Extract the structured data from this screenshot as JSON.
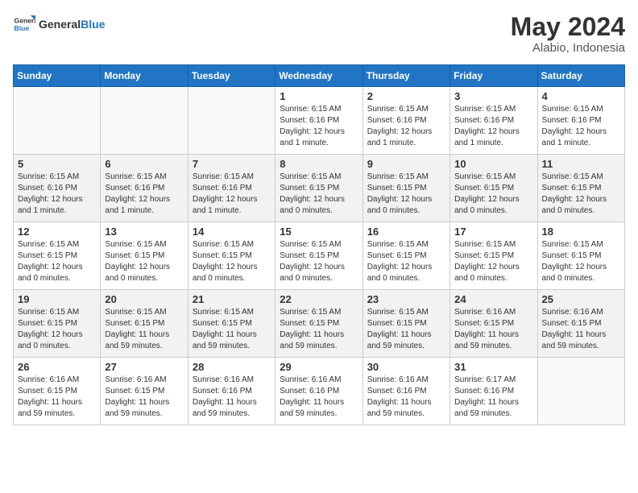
{
  "logo": {
    "general": "General",
    "blue": "Blue"
  },
  "title": "May 2024",
  "subtitle": "Alabio, Indonesia",
  "weekdays": [
    "Sunday",
    "Monday",
    "Tuesday",
    "Wednesday",
    "Thursday",
    "Friday",
    "Saturday"
  ],
  "weeks": [
    [
      {
        "day": "",
        "info": ""
      },
      {
        "day": "",
        "info": ""
      },
      {
        "day": "",
        "info": ""
      },
      {
        "day": "1",
        "info": "Sunrise: 6:15 AM\nSunset: 6:16 PM\nDaylight: 12 hours\nand 1 minute."
      },
      {
        "day": "2",
        "info": "Sunrise: 6:15 AM\nSunset: 6:16 PM\nDaylight: 12 hours\nand 1 minute."
      },
      {
        "day": "3",
        "info": "Sunrise: 6:15 AM\nSunset: 6:16 PM\nDaylight: 12 hours\nand 1 minute."
      },
      {
        "day": "4",
        "info": "Sunrise: 6:15 AM\nSunset: 6:16 PM\nDaylight: 12 hours\nand 1 minute."
      }
    ],
    [
      {
        "day": "5",
        "info": "Sunrise: 6:15 AM\nSunset: 6:16 PM\nDaylight: 12 hours\nand 1 minute."
      },
      {
        "day": "6",
        "info": "Sunrise: 6:15 AM\nSunset: 6:16 PM\nDaylight: 12 hours\nand 1 minute."
      },
      {
        "day": "7",
        "info": "Sunrise: 6:15 AM\nSunset: 6:16 PM\nDaylight: 12 hours\nand 1 minute."
      },
      {
        "day": "8",
        "info": "Sunrise: 6:15 AM\nSunset: 6:15 PM\nDaylight: 12 hours\nand 0 minutes."
      },
      {
        "day": "9",
        "info": "Sunrise: 6:15 AM\nSunset: 6:15 PM\nDaylight: 12 hours\nand 0 minutes."
      },
      {
        "day": "10",
        "info": "Sunrise: 6:15 AM\nSunset: 6:15 PM\nDaylight: 12 hours\nand 0 minutes."
      },
      {
        "day": "11",
        "info": "Sunrise: 6:15 AM\nSunset: 6:15 PM\nDaylight: 12 hours\nand 0 minutes."
      }
    ],
    [
      {
        "day": "12",
        "info": "Sunrise: 6:15 AM\nSunset: 6:15 PM\nDaylight: 12 hours\nand 0 minutes."
      },
      {
        "day": "13",
        "info": "Sunrise: 6:15 AM\nSunset: 6:15 PM\nDaylight: 12 hours\nand 0 minutes."
      },
      {
        "day": "14",
        "info": "Sunrise: 6:15 AM\nSunset: 6:15 PM\nDaylight: 12 hours\nand 0 minutes."
      },
      {
        "day": "15",
        "info": "Sunrise: 6:15 AM\nSunset: 6:15 PM\nDaylight: 12 hours\nand 0 minutes."
      },
      {
        "day": "16",
        "info": "Sunrise: 6:15 AM\nSunset: 6:15 PM\nDaylight: 12 hours\nand 0 minutes."
      },
      {
        "day": "17",
        "info": "Sunrise: 6:15 AM\nSunset: 6:15 PM\nDaylight: 12 hours\nand 0 minutes."
      },
      {
        "day": "18",
        "info": "Sunrise: 6:15 AM\nSunset: 6:15 PM\nDaylight: 12 hours\nand 0 minutes."
      }
    ],
    [
      {
        "day": "19",
        "info": "Sunrise: 6:15 AM\nSunset: 6:15 PM\nDaylight: 12 hours\nand 0 minutes."
      },
      {
        "day": "20",
        "info": "Sunrise: 6:15 AM\nSunset: 6:15 PM\nDaylight: 11 hours\nand 59 minutes."
      },
      {
        "day": "21",
        "info": "Sunrise: 6:15 AM\nSunset: 6:15 PM\nDaylight: 11 hours\nand 59 minutes."
      },
      {
        "day": "22",
        "info": "Sunrise: 6:15 AM\nSunset: 6:15 PM\nDaylight: 11 hours\nand 59 minutes."
      },
      {
        "day": "23",
        "info": "Sunrise: 6:15 AM\nSunset: 6:15 PM\nDaylight: 11 hours\nand 59 minutes."
      },
      {
        "day": "24",
        "info": "Sunrise: 6:16 AM\nSunset: 6:15 PM\nDaylight: 11 hours\nand 59 minutes."
      },
      {
        "day": "25",
        "info": "Sunrise: 6:16 AM\nSunset: 6:15 PM\nDaylight: 11 hours\nand 59 minutes."
      }
    ],
    [
      {
        "day": "26",
        "info": "Sunrise: 6:16 AM\nSunset: 6:15 PM\nDaylight: 11 hours\nand 59 minutes."
      },
      {
        "day": "27",
        "info": "Sunrise: 6:16 AM\nSunset: 6:15 PM\nDaylight: 11 hours\nand 59 minutes."
      },
      {
        "day": "28",
        "info": "Sunrise: 6:16 AM\nSunset: 6:16 PM\nDaylight: 11 hours\nand 59 minutes."
      },
      {
        "day": "29",
        "info": "Sunrise: 6:16 AM\nSunset: 6:16 PM\nDaylight: 11 hours\nand 59 minutes."
      },
      {
        "day": "30",
        "info": "Sunrise: 6:16 AM\nSunset: 6:16 PM\nDaylight: 11 hours\nand 59 minutes."
      },
      {
        "day": "31",
        "info": "Sunrise: 6:17 AM\nSunset: 6:16 PM\nDaylight: 11 hours\nand 59 minutes."
      },
      {
        "day": "",
        "info": ""
      }
    ]
  ]
}
